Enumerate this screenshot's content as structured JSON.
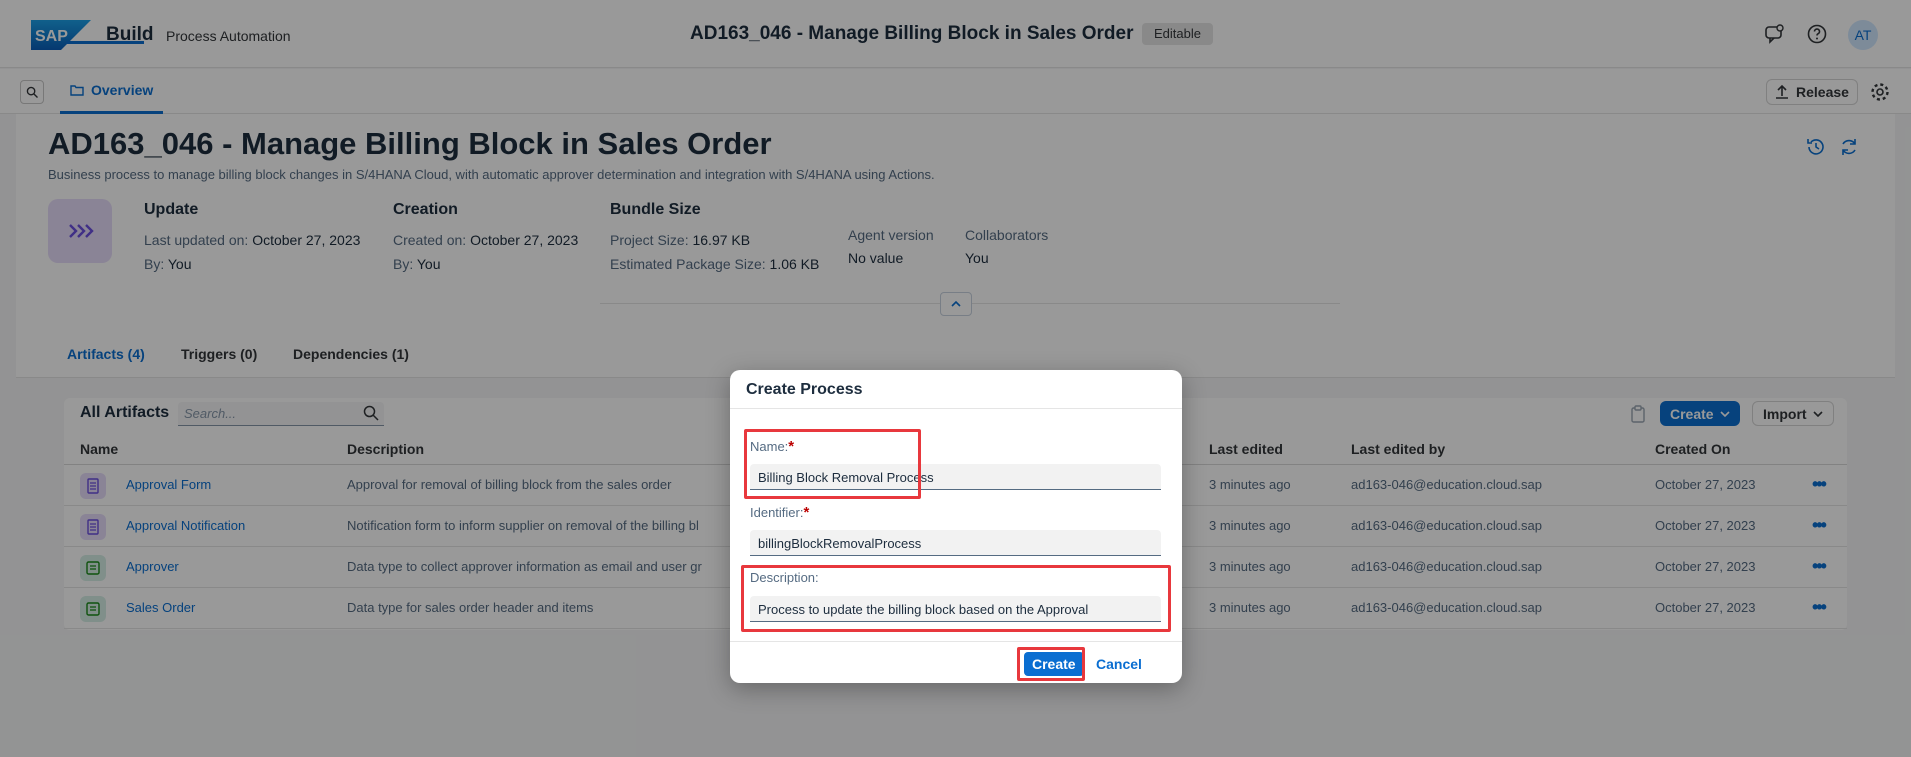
{
  "shell": {
    "logo_text": "SAP",
    "app_name": "Build",
    "sub_name": "Process Automation",
    "title": "AD163_046 - Manage Billing Block in Sales Order",
    "badge": "Editable",
    "avatar": "AT",
    "icons": [
      "feedback-icon",
      "help-icon"
    ]
  },
  "tabbar": {
    "tab_overview": "Overview",
    "release_label": "Release"
  },
  "header": {
    "title": "AD163_046 - Manage Billing Block in Sales Order",
    "description": "Business process to manage billing block changes in S/4HANA Cloud, with automatic approver determination and integration with S/4HANA using Actions.",
    "update": {
      "title": "Update",
      "last_updated_label": "Last updated on:",
      "last_updated_value": "October 27, 2023",
      "by_label": "By:",
      "by_value": "You"
    },
    "creation": {
      "title": "Creation",
      "created_label": "Created on:",
      "created_value": "October 27, 2023",
      "by_label": "By:",
      "by_value": "You"
    },
    "bundle": {
      "title": "Bundle Size",
      "project_label": "Project Size:",
      "project_value": "16.97 KB",
      "package_label": "Estimated Package Size:",
      "package_value": "1.06 KB"
    },
    "agent": {
      "label": "Agent version",
      "value": "No value"
    },
    "collaborators": {
      "label": "Collaborators",
      "value": "You"
    }
  },
  "section_tabs": [
    "Artifacts (4)",
    "Triggers (0)",
    "Dependencies (1)"
  ],
  "artifacts": {
    "title": "All Artifacts",
    "search_placeholder": "Search...",
    "create_label": "Create",
    "import_label": "Import",
    "columns": [
      "Name",
      "Description",
      "Last edited",
      "Last edited by",
      "Created On"
    ],
    "rows": [
      {
        "name": "Approval Form",
        "description": "Approval for removal of billing block from the sales order",
        "last_edited": "3 minutes ago",
        "edited_by": "ad163-046@education.cloud.sap",
        "created_on": "October 27, 2023",
        "icon": "form-icon"
      },
      {
        "name": "Approval Notification",
        "description": "Notification form to inform supplier on removal of the billing bl",
        "last_edited": "3 minutes ago",
        "edited_by": "ad163-046@education.cloud.sap",
        "created_on": "October 27, 2023",
        "icon": "form-icon"
      },
      {
        "name": "Approver",
        "description": "Data type to collect approver information as email and user gr",
        "last_edited": "3 minutes ago",
        "edited_by": "ad163-046@education.cloud.sap",
        "created_on": "October 27, 2023",
        "icon": "data-type-icon"
      },
      {
        "name": "Sales Order",
        "description": "Data type for sales order header and items",
        "last_edited": "3 minutes ago",
        "edited_by": "ad163-046@education.cloud.sap",
        "created_on": "October 27, 2023",
        "icon": "data-type-icon"
      }
    ]
  },
  "dialog": {
    "title": "Create Process",
    "name_label": "Name:",
    "name_value": "Billing Block Removal Process",
    "identifier_label": "Identifier:",
    "identifier_value": "billingBlockRemovalProcess",
    "description_label": "Description:",
    "description_value": "Process to update the billing block based on the Approval",
    "required_mark": "*",
    "create_label": "Create",
    "cancel_label": "Cancel"
  },
  "colors": {
    "accent": "#0a6ed1",
    "highlight": "#e8383d",
    "form_icon_bg": "#e6dcfb",
    "data_type_icon_bg": "#d5efe6"
  }
}
